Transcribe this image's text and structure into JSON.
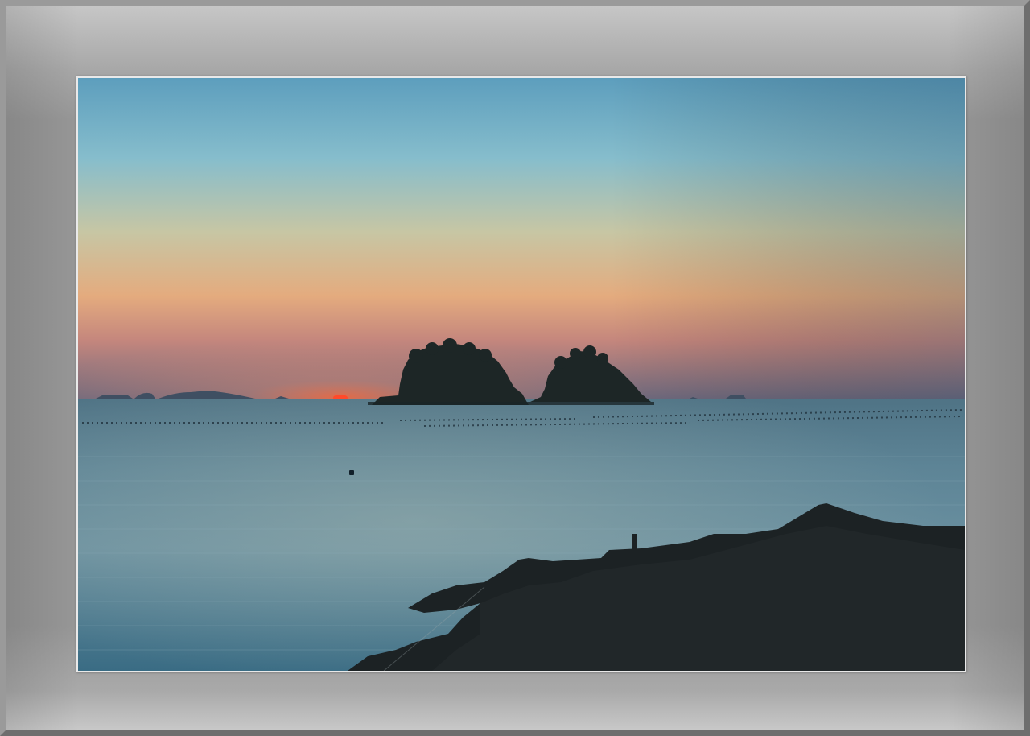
{
  "scene": {
    "sky_colors": [
      "#5f9fbb",
      "#8cbfcc",
      "#c8c7a6",
      "#e5a67f",
      "#9e7380"
    ],
    "sea_colors": [
      "#5d7f93",
      "#3f6e83",
      "#2c566c"
    ],
    "sun_color": "#ff4a2a",
    "icons": [
      "island-silhouette",
      "rock-silhouette",
      "sun-icon",
      "buoy-icon"
    ]
  }
}
